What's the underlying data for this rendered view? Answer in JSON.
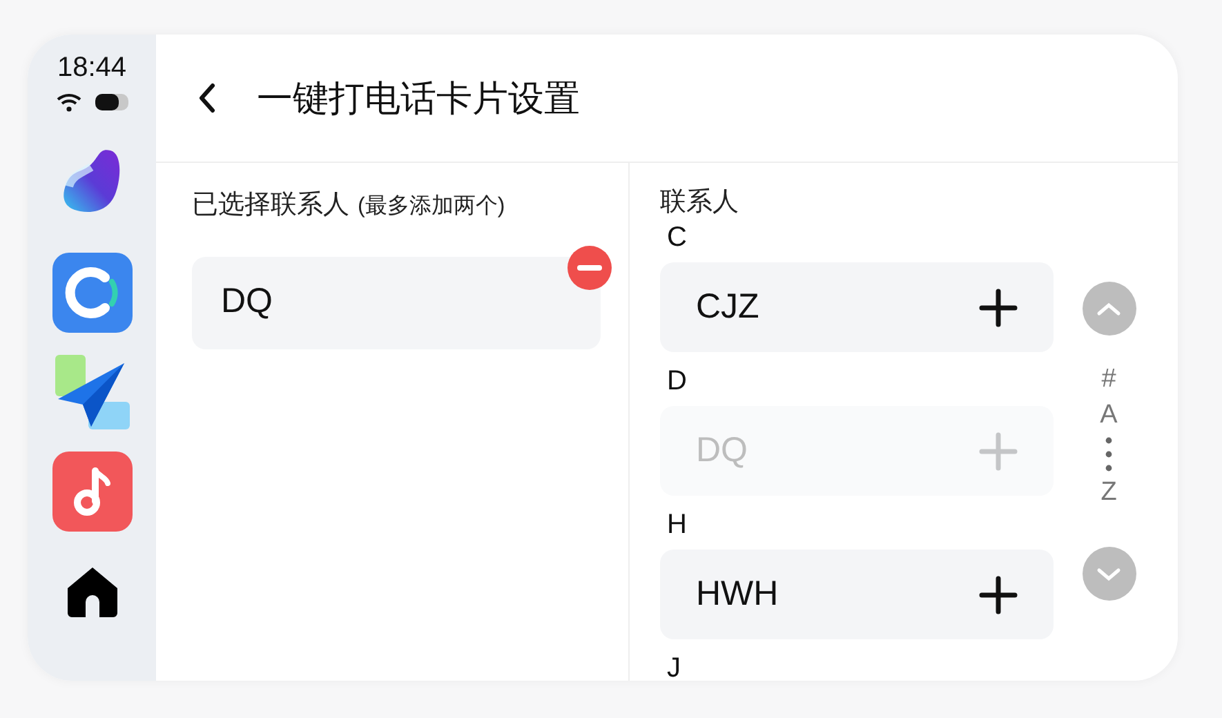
{
  "status_bar": {
    "time": "18:44"
  },
  "header": {
    "title": "一键打电话卡片设置"
  },
  "selected_panel": {
    "heading": "已选择联系人",
    "note": "(最多添加两个)",
    "items": [
      {
        "name": "DQ"
      }
    ]
  },
  "contacts_panel": {
    "heading": "联系人",
    "groups": [
      {
        "letter": "C",
        "items": [
          {
            "name": "CJZ",
            "disabled": false
          }
        ]
      },
      {
        "letter": "D",
        "items": [
          {
            "name": "DQ",
            "disabled": true
          }
        ]
      },
      {
        "letter": "H",
        "items": [
          {
            "name": "HWH",
            "disabled": false
          }
        ]
      },
      {
        "letter": "J"
      }
    ],
    "index": [
      {
        "kind": "letter",
        "label": "#"
      },
      {
        "kind": "letter",
        "label": "A"
      },
      {
        "kind": "dots"
      },
      {
        "kind": "letter",
        "label": "Z"
      }
    ]
  }
}
